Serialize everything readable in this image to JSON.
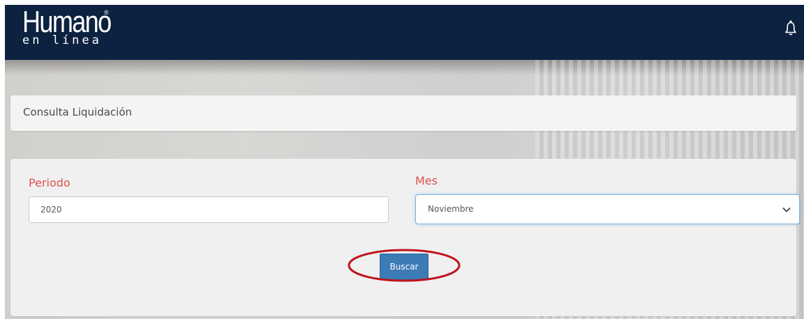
{
  "header": {
    "logo_main": "Humano",
    "logo_sub": "en línea",
    "logo_reg": "®",
    "bell_icon": "bell-icon",
    "background_color": "#0d2140"
  },
  "page": {
    "title": "Consulta Liquidación"
  },
  "form": {
    "periodo": {
      "label": "Periodo",
      "value": "2020"
    },
    "mes": {
      "label": "Mes",
      "selected": "Noviembre",
      "icon": "chevron-down-icon"
    },
    "search_button_label": "Buscar"
  },
  "colors": {
    "label_red": "#d9534f",
    "button_blue": "#3c7bb5",
    "highlight_ring": "#c0141c",
    "focus_border": "#7fb0dc"
  }
}
